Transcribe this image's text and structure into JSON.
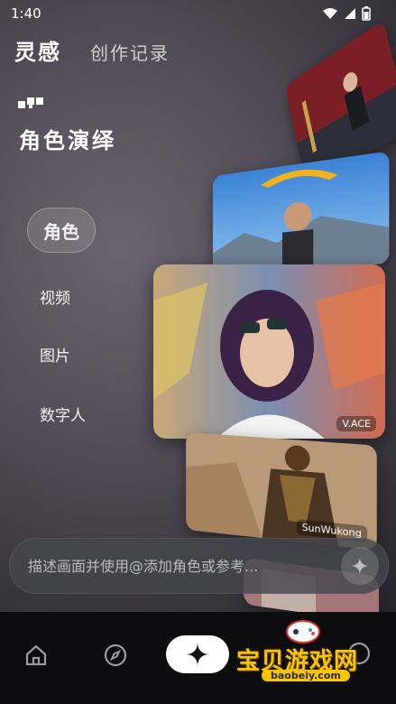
{
  "status_bar": {
    "time": "1:40"
  },
  "top_tabs": {
    "active": "灵感",
    "inactive": "创作记录"
  },
  "section": {
    "title": "角色演绎"
  },
  "menu": {
    "items": [
      "角色",
      "视频",
      "图片",
      "数字人"
    ],
    "selected": "角色"
  },
  "cards": [
    {
      "label": ""
    },
    {
      "label": ""
    },
    {
      "label": "V.ACE"
    },
    {
      "label": "SunWukong"
    },
    {
      "label": ""
    }
  ],
  "prompt": {
    "placeholder": "描述画面并使用@添加角色或参考..."
  },
  "bottom_nav": [
    "home-icon",
    "explore-icon",
    "create-icon",
    "profile-icon"
  ],
  "watermark": {
    "text": "宝贝游戏网",
    "url": "baobeiy.com"
  },
  "colors": {
    "accent": "#ffffff",
    "watermark": "#f7c600"
  }
}
